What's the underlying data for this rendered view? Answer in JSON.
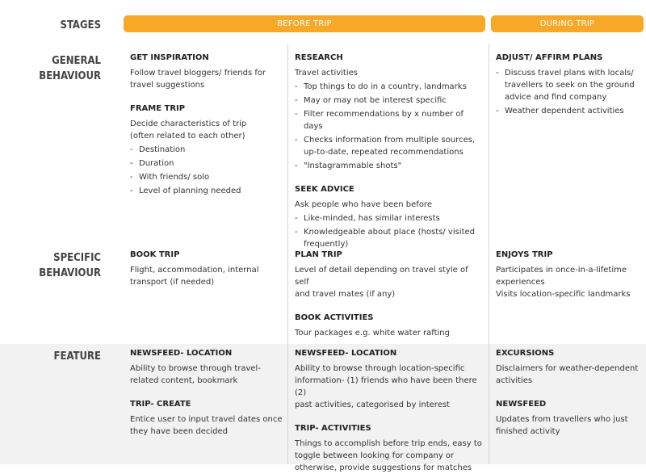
{
  "stages": {
    "label": "STAGES",
    "before_trip": "BEFORE TRIP",
    "during_trip": "DURING TRIP"
  },
  "row_labels": {
    "general": "GENERAL\nBEHAVIOUR",
    "specific": "SPECIFIC\nBEHAVIOUR",
    "feature": "FEATURE"
  },
  "cells": {
    "general_1": [
      {
        "heading": "GET INSPIRATION",
        "text": "Follow travel bloggers/ friends for\ntravel suggestions",
        "bullets": []
      },
      {
        "heading": "FRAME TRIP",
        "text": "Decide characteristics of trip\n(often related to each other)",
        "bullets": [
          "Destination",
          "Duration",
          "With friends/ solo",
          "Level of planning needed"
        ]
      }
    ],
    "general_2": [
      {
        "heading": "RESEARCH",
        "text": "Travel activities",
        "bullets": [
          "Top things to do in a country, landmarks",
          "May or may not be interest specific",
          "Filter recommendations by x number of days",
          "Checks information from multiple sources,\nup-to-date, repeated recommendations",
          "\"Instagrammable shots\""
        ]
      },
      {
        "heading": "SEEK ADVICE",
        "text": "Ask people who have been before",
        "bullets": [
          "Like-minded, has similar interests",
          "Knowledgeable about place (hosts/ visited\nfrequently)"
        ]
      }
    ],
    "general_3": [
      {
        "heading": "ADJUST/ AFFIRM PLANS",
        "text": "",
        "bullets": [
          "Discuss travel plans with locals/\ntravellers to seek on the ground\nadvice and find company",
          "Weather dependent activities"
        ]
      }
    ],
    "specific_1": [
      {
        "heading": "BOOK TRIP",
        "text": "Flight, accommodation, internal\ntransport (if needed)",
        "bullets": []
      }
    ],
    "specific_2": [
      {
        "heading": "PLAN TRIP",
        "text": "Level of detail depending on travel style of self\nand travel mates (if any)",
        "bullets": []
      },
      {
        "heading": "BOOK ACTIVITIES",
        "text": "Tour packages e.g. white water rafting",
        "bullets": []
      }
    ],
    "specific_3": [
      {
        "heading": "ENJOYS TRIP",
        "text": "Participates in once-in-a-lifetime\nexperiences\nVisits location-specific landmarks",
        "bullets": []
      }
    ],
    "feature_1": [
      {
        "heading": "NEWSFEED- LOCATION",
        "text": "Ability to browse through travel-\nrelated content, bookmark",
        "bullets": []
      },
      {
        "heading": "TRIP- CREATE",
        "text": "Entice user to input travel dates once\nthey have been decided",
        "bullets": []
      }
    ],
    "feature_2": [
      {
        "heading": "NEWSFEED- LOCATION",
        "text": "Ability to browse through location-specific\ninformation- (1) friends who have been there (2)\npast activities, categorised by interest",
        "bullets": []
      },
      {
        "heading": "TRIP- ACTIVITIES",
        "text": "Things to accomplish before trip ends, easy to\ntoggle between looking for company or\notherwise, provide suggestions for matches",
        "bullets": []
      }
    ],
    "feature_3": [
      {
        "heading": "EXCURSIONS",
        "text": "Disclaimers for weather-dependent\nactivities",
        "bullets": []
      },
      {
        "heading": "NEWSFEED",
        "text": "Updates from travellers who just\nfinished activity",
        "bullets": []
      }
    ]
  }
}
